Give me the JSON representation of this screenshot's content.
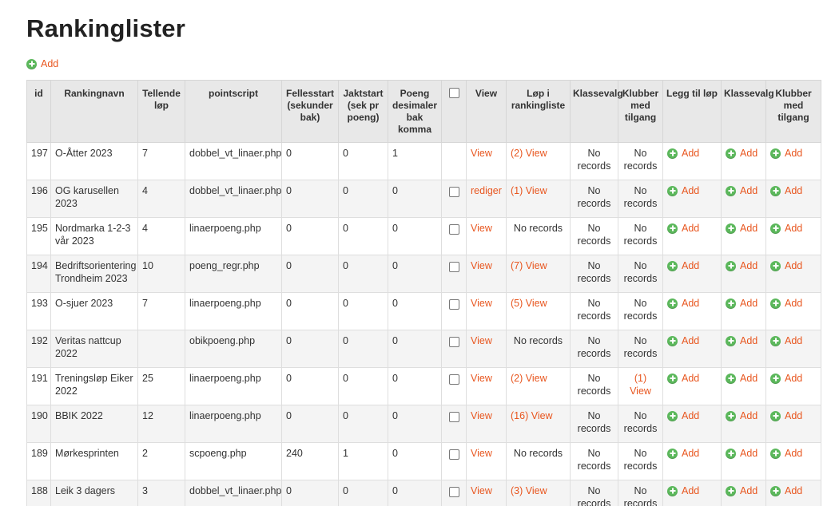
{
  "page": {
    "title": "Rankinglister",
    "add_label": "Add"
  },
  "columns": {
    "id": "id",
    "name": "Rankingnavn",
    "counting": "Tellende løp",
    "script": "pointscript",
    "mass_start": "Fellesstart (sekunder bak)",
    "chase_start": "Jaktstart (sek pr poeng)",
    "decimals": "Poeng desimaler bak komma",
    "view": "View",
    "races": "Løp i rankingliste",
    "class_select": "Klassevalg",
    "clubs": "Klubber med tilgang",
    "add_race": "Legg til løp",
    "class_select2": "Klassevalg",
    "clubs2": "Klubber med tilgang"
  },
  "rows": [
    {
      "id": "197",
      "name": "O-Åtter 2023",
      "counting": "7",
      "script": "dobbel_vt_linaer.php",
      "mass": "0",
      "chase": "0",
      "decimals": "1",
      "checkbox": false,
      "view": "View",
      "races": "(2) View",
      "races_link": true,
      "class": "No records",
      "clubs": "No records",
      "clubs_link": false,
      "add1": "Add",
      "add2": "Add",
      "add3": "Add"
    },
    {
      "id": "196",
      "name": "OG karusellen 2023",
      "counting": "4",
      "script": "dobbel_vt_linaer.php",
      "mass": "0",
      "chase": "0",
      "decimals": "0",
      "checkbox": true,
      "view": "rediger",
      "races": "(1) View",
      "races_link": true,
      "class": "No records",
      "clubs": "No records",
      "clubs_link": false,
      "add1": "Add",
      "add2": "Add",
      "add3": "Add"
    },
    {
      "id": "195",
      "name": "Nordmarka 1-2-3 vår 2023",
      "counting": "4",
      "script": "linaerpoeng.php",
      "mass": "0",
      "chase": "0",
      "decimals": "0",
      "checkbox": true,
      "view": "View",
      "races": "No records",
      "races_link": false,
      "class": "No records",
      "clubs": "No records",
      "clubs_link": false,
      "add1": "Add",
      "add2": "Add",
      "add3": "Add"
    },
    {
      "id": "194",
      "name": "Bedriftsorientering Trondheim 2023",
      "counting": "10",
      "script": "poeng_regr.php",
      "mass": "0",
      "chase": "0",
      "decimals": "0",
      "checkbox": true,
      "view": "View",
      "races": "(7) View",
      "races_link": true,
      "class": "No records",
      "clubs": "No records",
      "clubs_link": false,
      "add1": "Add",
      "add2": "Add",
      "add3": "Add"
    },
    {
      "id": "193",
      "name": "O-sjuer 2023",
      "counting": "7",
      "script": "linaerpoeng.php",
      "mass": "0",
      "chase": "0",
      "decimals": "0",
      "checkbox": true,
      "view": "View",
      "races": "(5) View",
      "races_link": true,
      "class": "No records",
      "clubs": "No records",
      "clubs_link": false,
      "add1": "Add",
      "add2": "Add",
      "add3": "Add"
    },
    {
      "id": "192",
      "name": "Veritas nattcup 2022",
      "counting": "",
      "script": "obikpoeng.php",
      "mass": "0",
      "chase": "0",
      "decimals": "0",
      "checkbox": true,
      "view": "View",
      "races": "No records",
      "races_link": false,
      "class": "No records",
      "clubs": "No records",
      "clubs_link": false,
      "add1": "Add",
      "add2": "Add",
      "add3": "Add"
    },
    {
      "id": "191",
      "name": "Treningsløp Eiker 2022",
      "counting": "25",
      "script": "linaerpoeng.php",
      "mass": "0",
      "chase": "0",
      "decimals": "0",
      "checkbox": true,
      "view": "View",
      "races": "(2) View",
      "races_link": true,
      "class": "No records",
      "clubs": "(1) View",
      "clubs_link": true,
      "add1": "Add",
      "add2": "Add",
      "add3": "Add"
    },
    {
      "id": "190",
      "name": "BBIK 2022",
      "counting": "12",
      "script": "linaerpoeng.php",
      "mass": "0",
      "chase": "0",
      "decimals": "0",
      "checkbox": true,
      "view": "View",
      "races": "(16) View",
      "races_link": true,
      "class": "No records",
      "clubs": "No records",
      "clubs_link": false,
      "add1": "Add",
      "add2": "Add",
      "add3": "Add"
    },
    {
      "id": "189",
      "name": "Mørkesprinten",
      "counting": "2",
      "script": "scpoeng.php",
      "mass": "240",
      "chase": "1",
      "decimals": "0",
      "checkbox": true,
      "view": "View",
      "races": "No records",
      "races_link": false,
      "class": "No records",
      "clubs": "No records",
      "clubs_link": false,
      "add1": "Add",
      "add2": "Add",
      "add3": "Add"
    },
    {
      "id": "188",
      "name": "Leik 3 dagers",
      "counting": "3",
      "script": "dobbel_vt_linaer.php",
      "mass": "0",
      "chase": "0",
      "decimals": "0",
      "checkbox": true,
      "view": "View",
      "races": "(3) View",
      "races_link": true,
      "class": "No records",
      "clubs": "No records",
      "clubs_link": false,
      "add1": "Add",
      "add2": "Add",
      "add3": "Add"
    }
  ]
}
